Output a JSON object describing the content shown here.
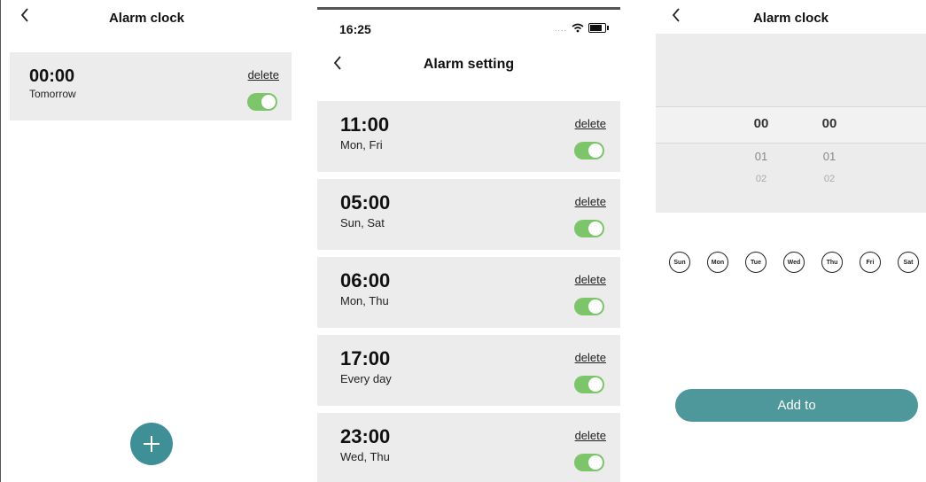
{
  "panel1": {
    "title": "Alarm clock",
    "alarm": {
      "time": "00:00",
      "days": "Tomorrow",
      "delete_label": "delete",
      "enabled": true
    }
  },
  "panel2": {
    "status_time": "16:25",
    "title": "Alarm setting",
    "alarms": [
      {
        "time": "11:00",
        "days": "Mon, Fri",
        "delete_label": "delete",
        "enabled": true
      },
      {
        "time": "05:00",
        "days": "Sun, Sat",
        "delete_label": "delete",
        "enabled": true
      },
      {
        "time": "06:00",
        "days": "Mon, Thu",
        "delete_label": "delete",
        "enabled": true
      },
      {
        "time": "17:00",
        "days": "Every day",
        "delete_label": "delete",
        "enabled": true
      },
      {
        "time": "23:00",
        "days": "Wed, Thu",
        "delete_label": "delete",
        "enabled": true
      }
    ]
  },
  "panel3": {
    "title": "Alarm clock",
    "picker": {
      "hours": [
        "00",
        "01",
        "02"
      ],
      "minutes": [
        "00",
        "01",
        "02"
      ]
    },
    "weekdays": [
      "Sun",
      "Mon",
      "Tue",
      "Wed",
      "Thu",
      "Fri",
      "Sat"
    ],
    "add_label": "Add to"
  },
  "colors": {
    "accent": "#3e9096",
    "toggle_on": "#7cc56b",
    "card_bg": "#ececec"
  },
  "icons": {
    "back": "chevron-left-icon",
    "add": "plus-icon",
    "wifi": "wifi-icon",
    "battery": "battery-icon"
  }
}
